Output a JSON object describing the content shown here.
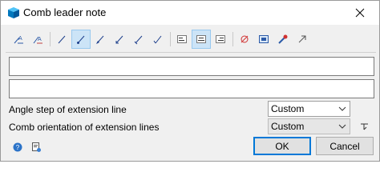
{
  "window": {
    "title": "Comb leader note"
  },
  "toolbar": {
    "buttons": [
      {
        "icon": "leader-note-text-icon",
        "active": false
      },
      {
        "icon": "leader-note-angled-icon",
        "active": false
      },
      {
        "icon": "line-style-plain-icon",
        "active": false
      },
      {
        "icon": "line-style-arrow-icon",
        "active": true
      },
      {
        "icon": "line-style-filled-arrow-icon",
        "active": false
      },
      {
        "icon": "line-style-open-arrow-icon",
        "active": false
      },
      {
        "icon": "line-style-slash-icon",
        "active": false
      },
      {
        "icon": "line-style-check-icon",
        "active": false
      },
      {
        "icon": "text-align-left-icon",
        "active": false
      },
      {
        "icon": "text-align-center-icon",
        "active": true
      },
      {
        "icon": "text-align-right-icon",
        "active": false
      },
      {
        "icon": "diameter-symbol-icon",
        "active": false
      },
      {
        "icon": "insert-image-icon",
        "active": false
      },
      {
        "icon": "special-symbols-icon",
        "active": false
      },
      {
        "icon": "format-pointer-icon",
        "active": false
      }
    ]
  },
  "fields": {
    "line1_value": "",
    "line2_value": ""
  },
  "angle_step": {
    "label": "Angle step of extension line",
    "value": "Custom"
  },
  "comb_orientation": {
    "label": "Comb orientation of extension lines",
    "value": "Custom"
  },
  "footer": {
    "ok_label": "OK",
    "cancel_label": "Cancel"
  },
  "colors": {
    "accent": "#0078d7",
    "active_button_bg": "#cce4f7"
  }
}
